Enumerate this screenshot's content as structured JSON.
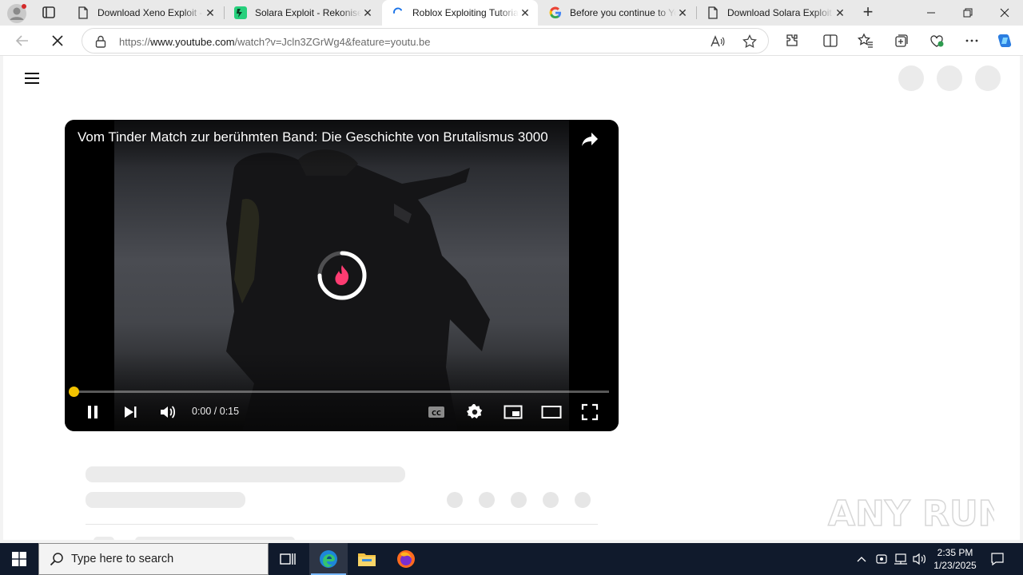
{
  "browser": {
    "tabs": [
      {
        "title": "Download Xeno Exploit - ",
        "icon": "page-icon"
      },
      {
        "title": "Solara Exploit - Rekonise",
        "icon": "rekonise-icon"
      },
      {
        "title": "Roblox Exploiting Tutoria",
        "icon": "loading-spinner-icon",
        "active": true
      },
      {
        "title": "Before you continue to Yo",
        "icon": "google-icon"
      },
      {
        "title": "Download Solara Exploit ",
        "icon": "page-icon"
      }
    ],
    "url_prefix": "https://",
    "url_host": "www.youtube.com",
    "url_path": "/watch?v=Jcln3ZGrWg4&feature=youtu.be"
  },
  "player": {
    "title": "Vom Tinder Match zur berühmten Band: Die Geschichte von Brutalismus 3000",
    "time": "0:00 / 0:15",
    "progress": 0.0,
    "accent_color": "#f2c200",
    "spinner_color": "#fe3c72"
  },
  "watermark": {
    "text": "ANY RUN"
  },
  "taskbar": {
    "search_placeholder": "Type here to search",
    "time": "2:35 PM",
    "date": "1/23/2025"
  }
}
